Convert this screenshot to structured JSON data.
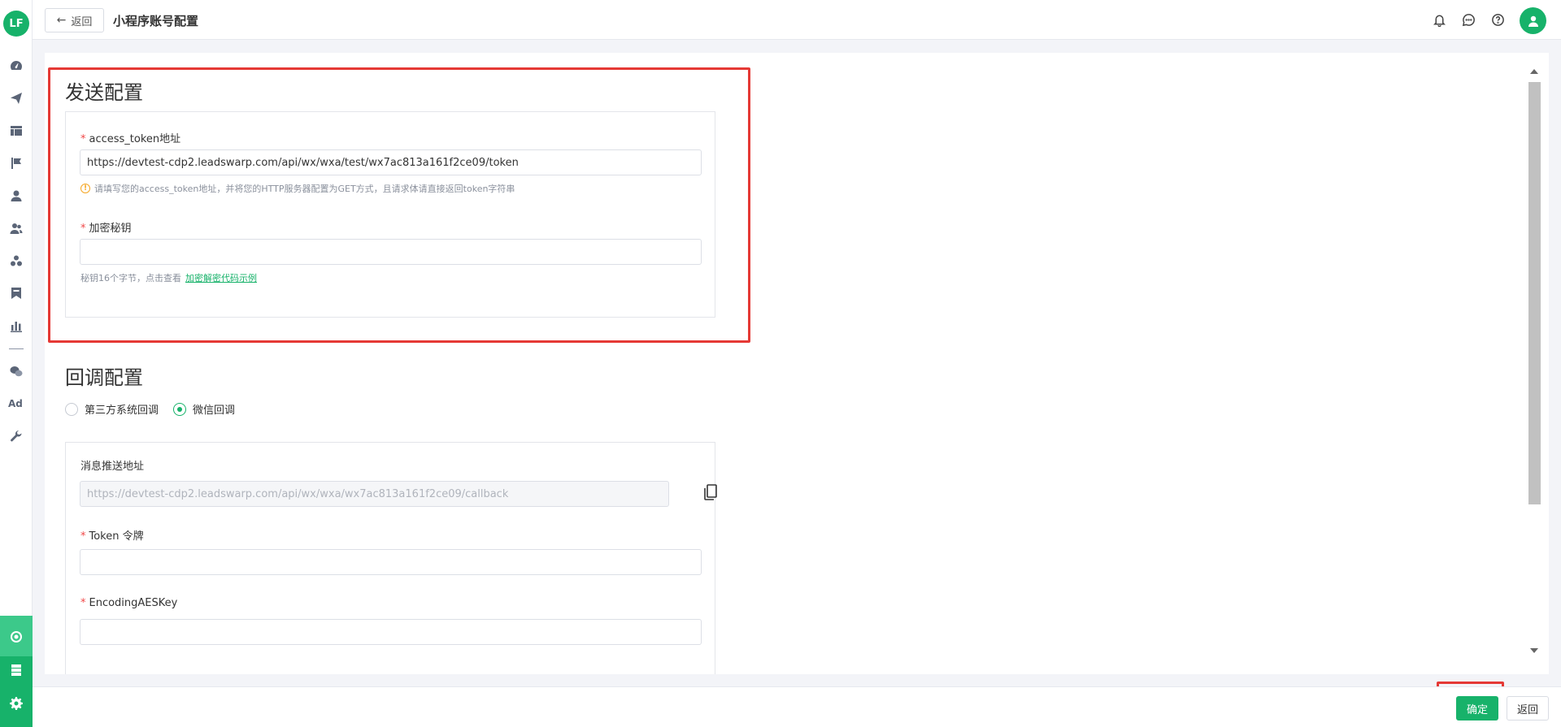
{
  "app": {
    "logo_text": "LF"
  },
  "header": {
    "back_label": "返回",
    "title": "小程序账号配置",
    "icons": [
      "bell-icon",
      "chat-icon",
      "help-icon",
      "user-avatar"
    ]
  },
  "sidebar": {
    "items": [
      {
        "icon": "dashboard-icon"
      },
      {
        "icon": "send-icon"
      },
      {
        "icon": "layout-icon"
      },
      {
        "icon": "flag-icon"
      },
      {
        "icon": "user-icon"
      },
      {
        "icon": "users-icon"
      },
      {
        "icon": "group-icon"
      },
      {
        "icon": "bookmark-icon"
      },
      {
        "icon": "bar-chart-icon"
      },
      {
        "icon": "wechat-icon"
      },
      {
        "icon": "ad-icon",
        "label": "Ad"
      },
      {
        "icon": "wrench-icon"
      }
    ],
    "bottom_items": [
      {
        "icon": "hub-icon",
        "active": true
      },
      {
        "icon": "server-icon"
      },
      {
        "icon": "settings-icon"
      }
    ]
  },
  "send_config": {
    "title": "发送配置",
    "access_token": {
      "label": "access_token地址",
      "required": "*",
      "value": "https://devtest-cdp2.leadswarp.com/api/wx/wxa/test/wx7ac813a161f2ce09/token",
      "hint": "请填写您的access_token地址，并将您的HTTP服务器配置为GET方式，且请求体请直接返回token字符串"
    },
    "secret_key": {
      "label": "加密秘钥",
      "required": "*",
      "value": "",
      "hint_text": "秘钥16个字节，点击查看",
      "hint_link": "加密解密代码示例"
    }
  },
  "callback_config": {
    "title": "回调配置",
    "options": [
      {
        "label": "第三方系统回调",
        "checked": false
      },
      {
        "label": "微信回调",
        "checked": true
      }
    ],
    "push_url": {
      "label": "消息推送地址",
      "placeholder": "https://devtest-cdp2.leadswarp.com/api/wx/wxa/wx7ac813a161f2ce09/callback"
    },
    "token": {
      "label": "Token 令牌",
      "required": "*",
      "value": ""
    },
    "aes_key": {
      "label": "EncodingAESKey",
      "required": "*",
      "value": ""
    }
  },
  "footer": {
    "confirm_label": "确定",
    "back_label": "返回"
  },
  "colors": {
    "accent": "#17b26a",
    "highlight": "#e53935"
  }
}
